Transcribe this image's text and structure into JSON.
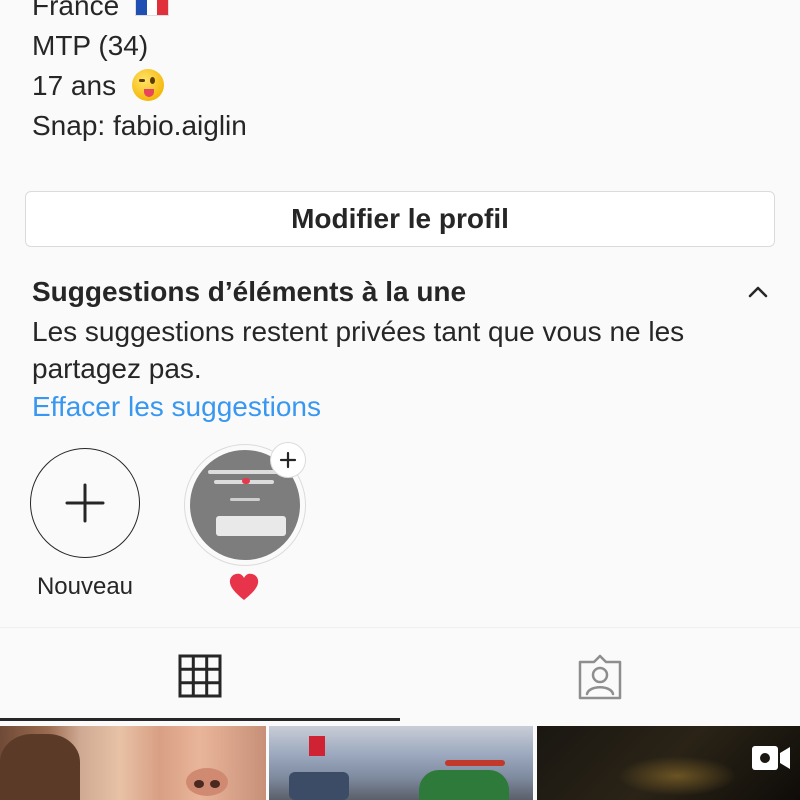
{
  "profile": {
    "bio_lines": [
      {
        "text": "France",
        "emoji": "france-flag"
      },
      {
        "text": "MTP (34)"
      },
      {
        "text": "17 ans",
        "emoji": "winking-face-with-tongue"
      },
      {
        "text": "Snap: fabio.aiglin"
      }
    ],
    "edit_profile_label": "Modifier le profil"
  },
  "suggestions": {
    "title": "Suggestions d’éléments à la une",
    "description": "Les suggestions restent privées tant que vous ne les partagez pas.",
    "clear_link": "Effacer les suggestions",
    "highlights": [
      {
        "label": "Nouveau",
        "icon": "plus-icon"
      },
      {
        "label": "",
        "icon": "heart-emoji"
      }
    ]
  },
  "tabs": [
    {
      "name": "grid",
      "icon": "grid-icon",
      "active": true
    },
    {
      "name": "tagged",
      "icon": "tagged-person-icon",
      "active": false
    }
  ],
  "posts": [
    {
      "type": "photo"
    },
    {
      "type": "photo"
    },
    {
      "type": "video",
      "icon": "video-icon"
    }
  ],
  "colors": {
    "text": "#262626",
    "link": "#3897f0",
    "border": "#dbdbdb",
    "background": "#fafafa",
    "heart": "#e8344a"
  }
}
